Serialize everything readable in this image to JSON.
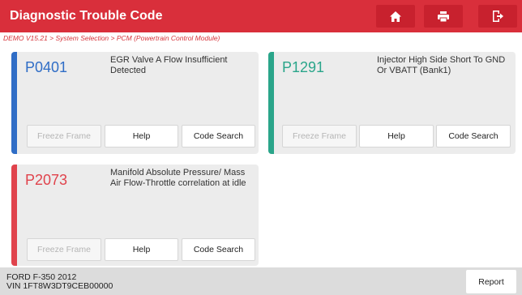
{
  "header": {
    "title": "Diagnostic Trouble Code",
    "icons": [
      "home-icon",
      "print-icon",
      "exit-icon"
    ]
  },
  "breadcrumb": "DEMO V15.21 > System Selection > PCM (Powertrain Control Module)",
  "cards": [
    {
      "code": "P0401",
      "description": "EGR Valve A Flow Insufficient Detected",
      "color": "#2f6dc6",
      "buttons": {
        "freeze_frame": "Freeze Frame",
        "help": "Help",
        "code_search": "Code Search"
      }
    },
    {
      "code": "P1291",
      "description": "Injector High Side Short To GND Or VBATT (Bank1)",
      "color": "#2aa58a",
      "buttons": {
        "freeze_frame": "Freeze Frame",
        "help": "Help",
        "code_search": "Code Search"
      }
    },
    {
      "code": "P2073",
      "description": "Manifold Absolute Pressure/ Mass Air Flow-Throttle correlation at idle",
      "color": "#e0434c",
      "buttons": {
        "freeze_frame": "Freeze Frame",
        "help": "Help",
        "code_search": "Code Search"
      }
    }
  ],
  "footer": {
    "vehicle": "FORD F-350 2012",
    "vin": "VIN 1FT8W3DT9CEB00000",
    "report_label": "Report"
  }
}
